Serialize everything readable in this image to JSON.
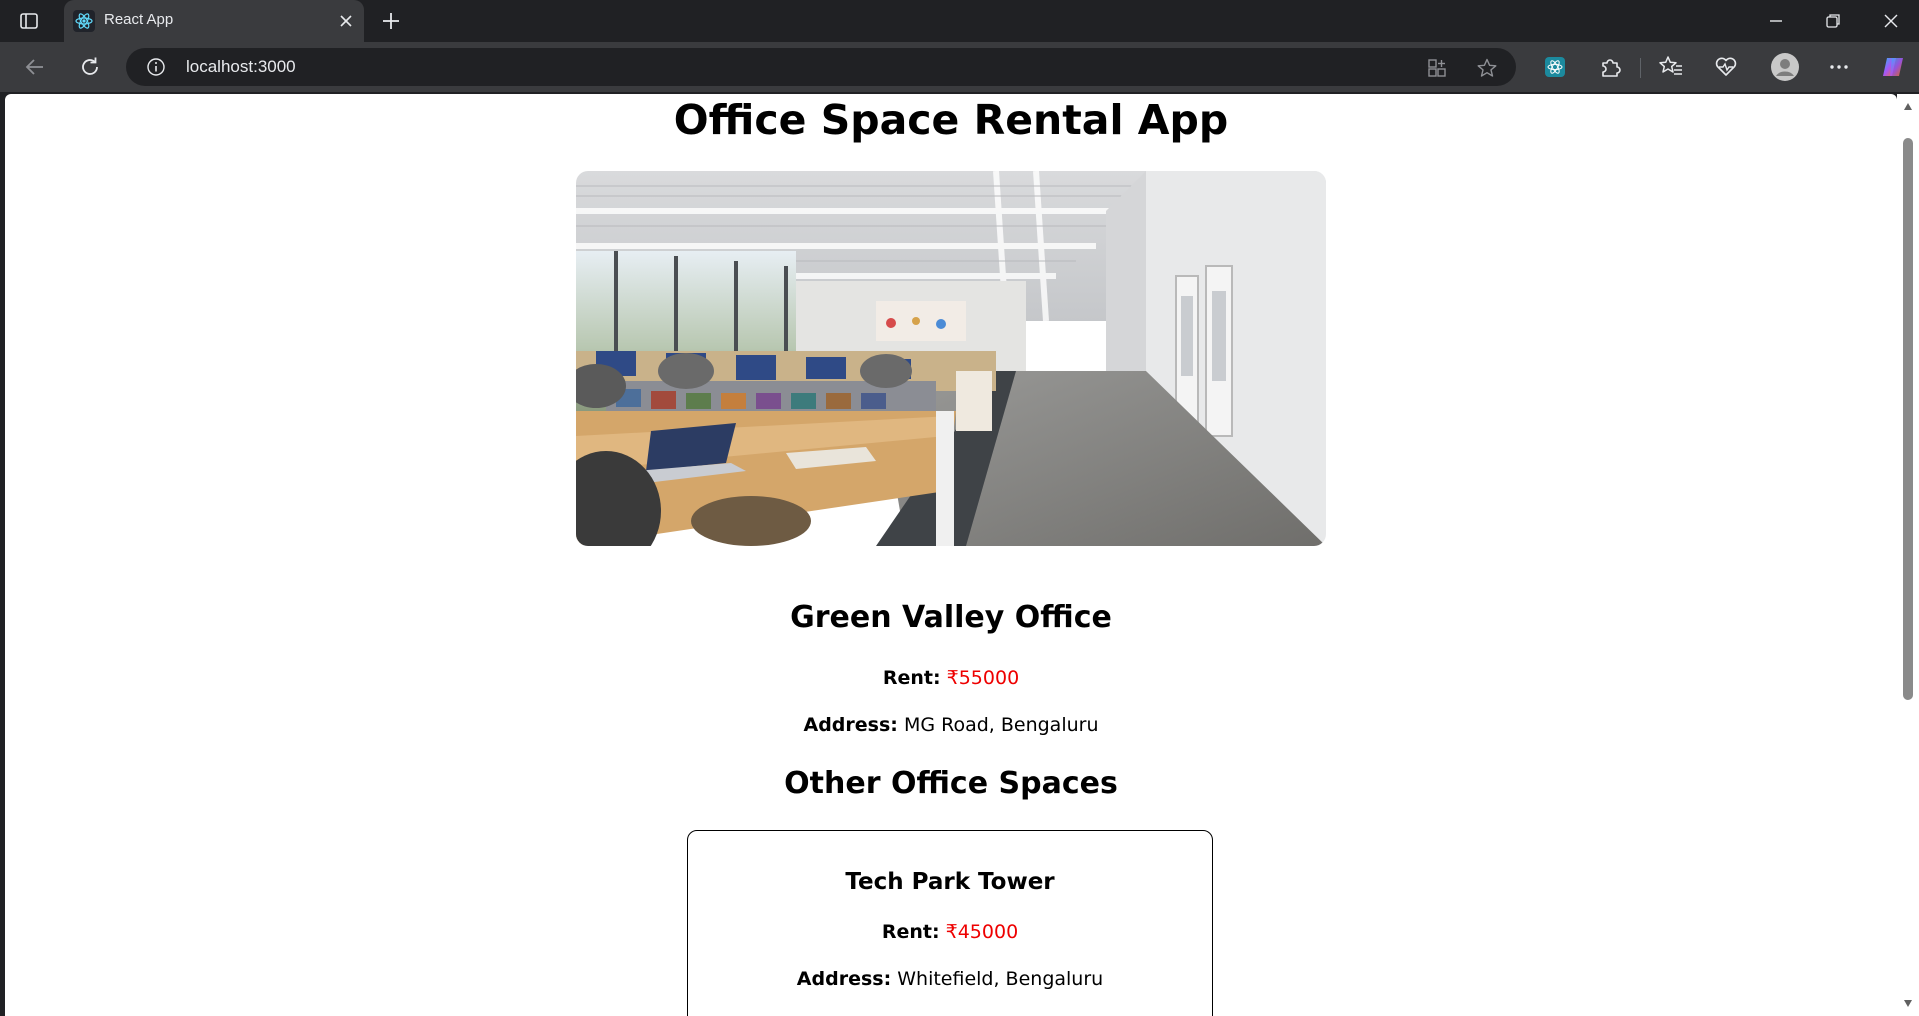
{
  "browser": {
    "tab_title": "React App",
    "url": "localhost:3000"
  },
  "icons": {
    "tab_favicon": "react-icon",
    "tab_close": "close-icon",
    "new_tab": "plus-icon",
    "back": "back-arrow-icon",
    "reload": "reload-icon",
    "site_info": "info-icon",
    "split_screen": "split-screen-icon",
    "favorite": "star-icon",
    "extension_badge": "extension-app-icon",
    "extensions": "puzzle-icon",
    "favorites_list": "favorites-icon",
    "health": "heart-pulse-icon",
    "profile": "avatar-icon",
    "more": "more-icon",
    "copilot": "copilot-icon"
  },
  "page": {
    "title": "Office Space Rental App",
    "hero_image": "office-photo",
    "featured": {
      "name": "Green Valley Office",
      "rent_label": "Rent:",
      "rent_value": "₹55000",
      "address_label": "Address:",
      "address_value": "MG Road, Bengaluru"
    },
    "other_title": "Other Office Spaces",
    "others": [
      {
        "name": "Tech Park Tower",
        "rent_label": "Rent:",
        "rent_value": "₹45000",
        "address_label": "Address:",
        "address_value": "Whitefield, Bengaluru"
      }
    ]
  },
  "colors": {
    "rent": "#ee0000",
    "chrome_bg": "#202124",
    "tab_active": "#3a3b3e"
  }
}
